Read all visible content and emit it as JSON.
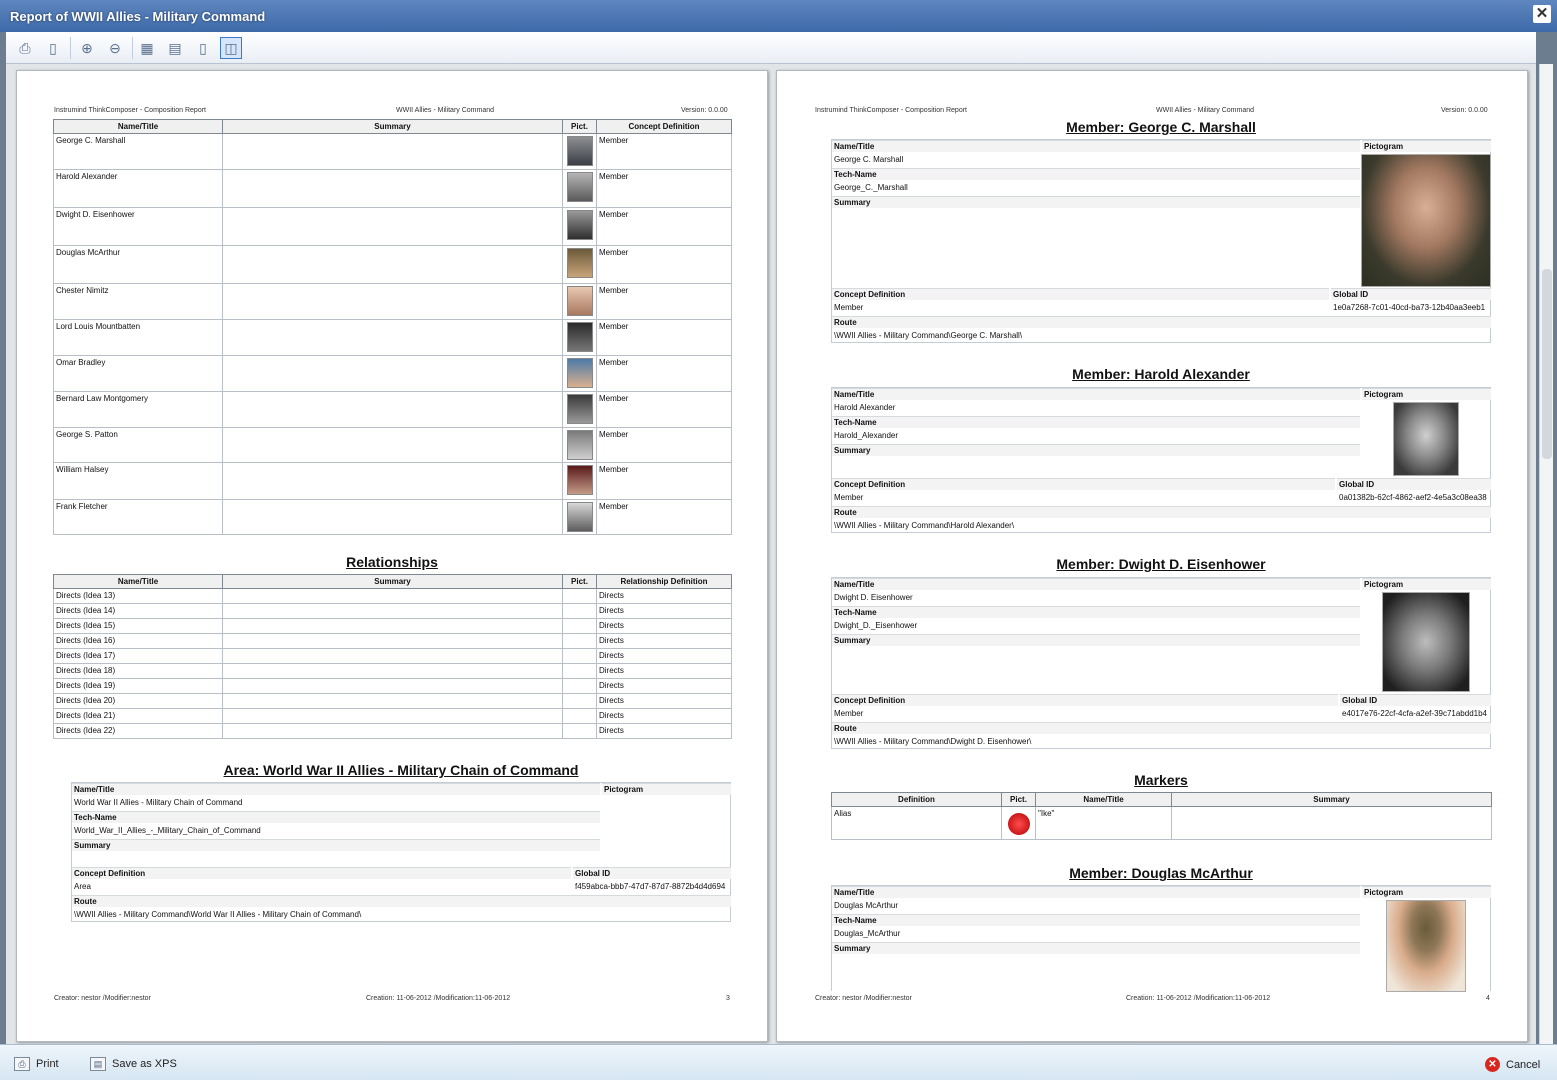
{
  "window": {
    "title": "Report of WWII Allies - Military Command",
    "close_glyph": "✕"
  },
  "toolbar": {
    "icons": [
      "print-icon",
      "copy-icon",
      "zoom-in-icon",
      "zoom-out-icon",
      "actual-size-icon",
      "page-width-icon",
      "whole-page-icon",
      "two-pages-icon"
    ]
  },
  "header": {
    "left": "Instrumind ThinkComposer - Composition Report",
    "center": "WWII Allies - Military Command",
    "right": "Version: 0.0.00"
  },
  "page3": {
    "members_table": {
      "columns": [
        "Name/Title",
        "Summary",
        "Pict.",
        "Concept Definition"
      ],
      "rows": [
        {
          "name": "George C. Marshall",
          "def": "Member"
        },
        {
          "name": "Harold Alexander",
          "def": "Member"
        },
        {
          "name": "Dwight D. Eisenhower",
          "def": "Member"
        },
        {
          "name": "Douglas McArthur",
          "def": "Member"
        },
        {
          "name": "Chester Nimitz",
          "def": "Member"
        },
        {
          "name": "Lord Louis Mountbatten",
          "def": "Member"
        },
        {
          "name": "Omar Bradley",
          "def": "Member"
        },
        {
          "name": "Bernard Law Montgomery",
          "def": "Member"
        },
        {
          "name": "George S. Patton",
          "def": "Member"
        },
        {
          "name": "William Halsey",
          "def": "Member"
        },
        {
          "name": "Frank Fletcher",
          "def": "Member"
        }
      ]
    },
    "relationships": {
      "title": "Relationships",
      "columns": [
        "Name/Title",
        "Summary",
        "Pict.",
        "Relationship Definition"
      ],
      "rows": [
        {
          "name": "Directs (Idea 13)",
          "def": "Directs"
        },
        {
          "name": "Directs (Idea 14)",
          "def": "Directs"
        },
        {
          "name": "Directs (Idea 15)",
          "def": "Directs"
        },
        {
          "name": "Directs (Idea 16)",
          "def": "Directs"
        },
        {
          "name": "Directs (Idea 17)",
          "def": "Directs"
        },
        {
          "name": "Directs (Idea 18)",
          "def": "Directs"
        },
        {
          "name": "Directs (Idea 19)",
          "def": "Directs"
        },
        {
          "name": "Directs (Idea 20)",
          "def": "Directs"
        },
        {
          "name": "Directs (Idea 21)",
          "def": "Directs"
        },
        {
          "name": "Directs (Idea 22)",
          "def": "Directs"
        }
      ]
    },
    "area": {
      "title": "Area: World War II Allies - Military Chain of Command",
      "name_label": "Name/Title",
      "name": "World War II Allies - Military Chain of Command",
      "tech_label": "Tech-Name",
      "tech": "World_War_II_Allies_-_Military_Chain_of_Command",
      "summary_label": "Summary",
      "pictogram_label": "Pictogram",
      "concept_label": "Concept Definition",
      "concept": "Area",
      "gid_label": "Global ID",
      "gid": "f459abca-bbb7-47d7-87d7-8872b4d4d694",
      "route_label": "Route",
      "route": "\\WWII Allies - Military Command\\World War II Allies - Military Chain of Command\\"
    },
    "footer": {
      "left": "Creator: nestor /Modifier:nestor",
      "center": "Creation: 11-06-2012 /Modification:11-06-2012",
      "right": "3"
    }
  },
  "page4": {
    "members": [
      {
        "title": "Member: George C. Marshall",
        "name": "George C. Marshall",
        "tech": "George_C._Marshall",
        "concept": "Member",
        "gid": "1e0a7268-7c01-40cd-ba73-12b40aa3eeb1",
        "route": "\\WWII Allies - Military Command\\George C. Marshall\\"
      },
      {
        "title": "Member: Harold Alexander",
        "name": "Harold Alexander",
        "tech": "Harold_Alexander",
        "concept": "Member",
        "gid": "0a01382b-62cf-4862-aef2-4e5a3c08ea38",
        "route": "\\WWII Allies - Military Command\\Harold Alexander\\"
      },
      {
        "title": "Member: Dwight D. Eisenhower",
        "name": "Dwight D. Eisenhower",
        "tech": "Dwight_D._Eisenhower",
        "concept": "Member",
        "gid": "e4017e76-22cf-4cfa-a2ef-39c71abdd1b4",
        "route": "\\WWII Allies - Military Command\\Dwight D. Eisenhower\\"
      },
      {
        "title": "Member: Douglas McArthur",
        "name": "Douglas McArthur",
        "tech": "Douglas_McArthur"
      }
    ],
    "labels": {
      "name": "Name/Title",
      "tech": "Tech-Name",
      "summary": "Summary",
      "pictogram": "Pictogram",
      "concept": "Concept Definition",
      "gid": "Global ID",
      "route": "Route"
    },
    "markers": {
      "title": "Markers",
      "columns": [
        "Definition",
        "Pict.",
        "Name/Title",
        "Summary"
      ],
      "row": {
        "definition": "Alias",
        "name": "\"Ike\""
      }
    },
    "footer": {
      "left": "Creator: nestor /Modifier:nestor",
      "center": "Creation: 11-06-2012 /Modification:11-06-2012",
      "right": "4"
    }
  },
  "statusbar": {
    "print": "Print",
    "save": "Save as XPS",
    "cancel": "Cancel"
  }
}
